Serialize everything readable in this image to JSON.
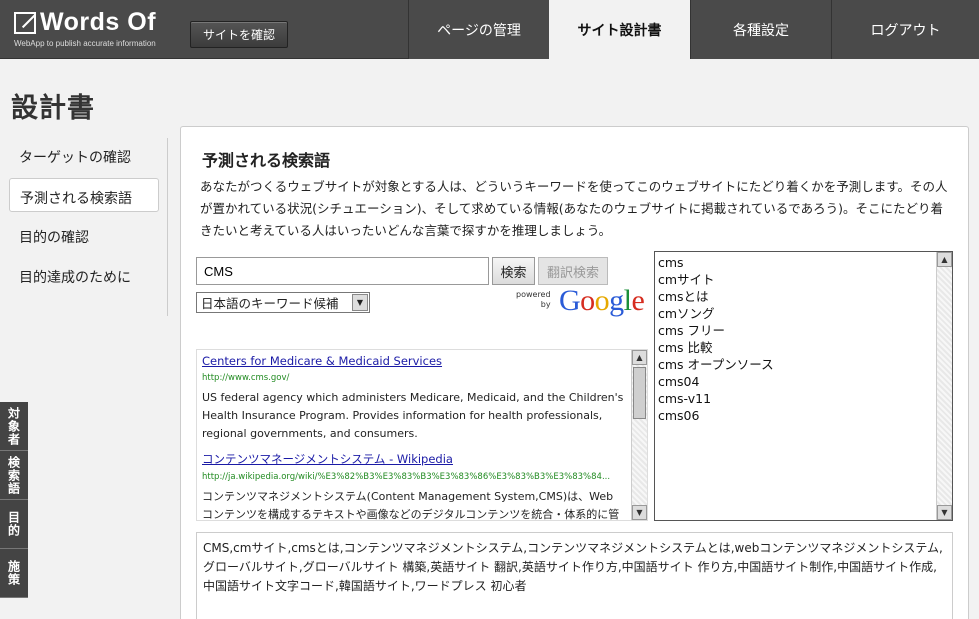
{
  "header": {
    "logo": {
      "name": "Words Of",
      "tagline": "WebApp to publish accurate information"
    },
    "site_button": "サイトを確認",
    "nav": [
      {
        "label": "ページの管理",
        "active": false
      },
      {
        "label": "サイト設計書",
        "active": true
      },
      {
        "label": "各種設定",
        "active": false
      },
      {
        "label": "ログアウト",
        "active": false
      }
    ]
  },
  "page_title": "設計書",
  "sidebar": {
    "items": [
      {
        "label": "ターゲットの確認",
        "active": false
      },
      {
        "label": "予測される検索語",
        "active": true
      },
      {
        "label": "目的の確認",
        "active": false
      },
      {
        "label": "目的達成のために",
        "active": false
      }
    ]
  },
  "vertical_tabs": [
    "対象者",
    "検索語",
    "目的",
    "施策"
  ],
  "main": {
    "title": "予測される検索語",
    "description": "あなたがつくるウェブサイトが対象とする人は、どういうキーワードを使ってこのウェブサイトにたどり着くかを予測します。その人が置かれている状況(シチュエーション)、そして求めている情報(あなたのウェブサイトに掲載されているであろう)。そこにたどり着きたいと考えている人はいったいどんな言葉で探すかを推理しましょう。",
    "search": {
      "value": "CMS",
      "search_button": "検索",
      "translate_button": "翻訳検索",
      "select_value": "日本語のキーワード候補"
    },
    "powered_by": {
      "line1": "powered",
      "line2": "by"
    },
    "google_letters": [
      "G",
      "o",
      "o",
      "g",
      "l",
      "e"
    ],
    "results": [
      {
        "title": "Centers for Medicare & Medicaid Services",
        "url": "http://www.cms.gov/",
        "snippet": "US federal agency which administers Medicare, Medicaid, and the Children's Health Insurance Program. Provides information for health professionals, regional governments, and consumers."
      },
      {
        "title": "コンテンツマネージメントシステム - Wikipedia",
        "url": "http://ja.wikipedia.org/wiki/%E3%82%B3%E3%83%B3%E3%83%86%E3%83%B3%E3%83%84...",
        "snippet": "コンテンツマネジメントシステム(Content Management System,CMS)は、Web コンテンツを構成するテキストや画像などのデジタルコンテンツを統合・体系的に管理し、"
      }
    ],
    "suggestions": [
      "cms",
      "cmサイト",
      "cmsとは",
      "cmソング",
      "cms フリー",
      "cms 比較",
      "cms オープンソース",
      "cms04",
      "cms-v11",
      "cms06"
    ],
    "keywords": "CMS,cmサイト,cmsとは,コンテンツマネジメントシステム,コンテンツマネジメントシステムとは,webコンテンツマネジメントシステム,グローバルサイト,グローバルサイト 構築,英語サイト 翻訳,英語サイト作り方,中国語サイト 作り方,中国語サイト制作,中国語サイト作成,中国語サイト文字コード,韓国語サイト,ワードプレス 初心者"
  }
}
